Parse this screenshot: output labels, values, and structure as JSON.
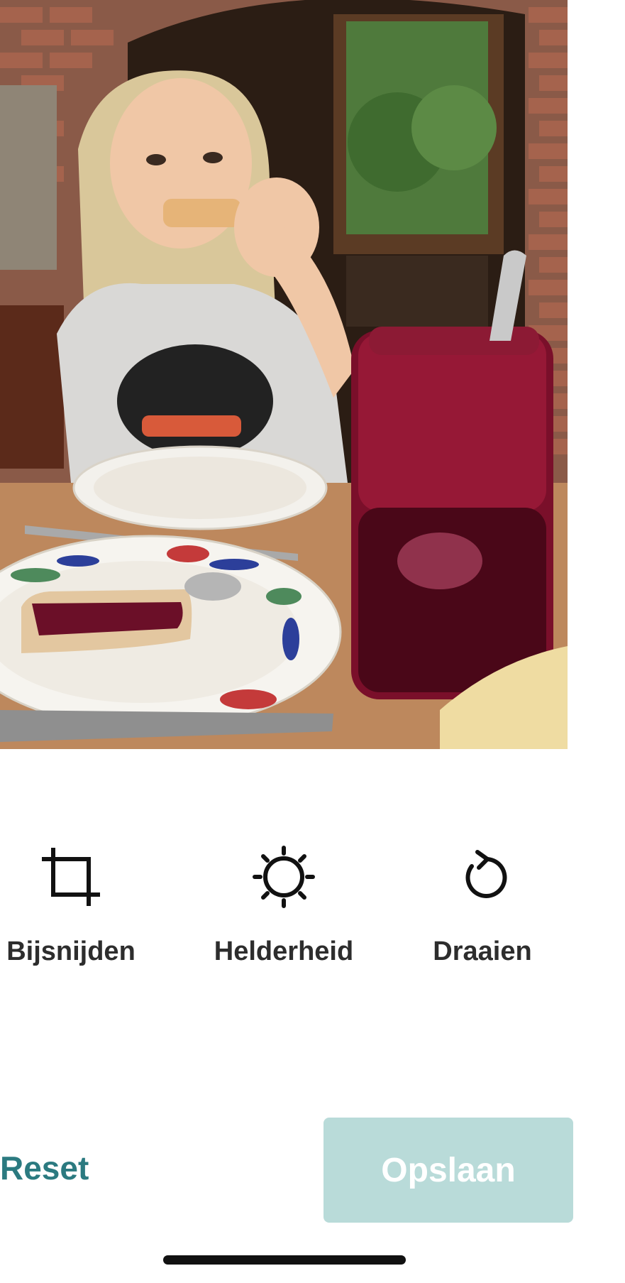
{
  "photo": {
    "subject": "child-eating-toast-with-jam"
  },
  "tools": [
    {
      "id": "crop",
      "label": "Bijsnijden",
      "icon": "crop-icon"
    },
    {
      "id": "brightness",
      "label": "Helderheid",
      "icon": "sun-icon"
    },
    {
      "id": "rotate",
      "label": "Draaien",
      "icon": "rotate-icon"
    }
  ],
  "actions": {
    "reset_label": "Reset",
    "save_label": "Opslaan"
  },
  "colors": {
    "accent": "#2b7a80",
    "save_disabled_bg": "#b9dbd9",
    "label_text": "#2d2d2d"
  }
}
